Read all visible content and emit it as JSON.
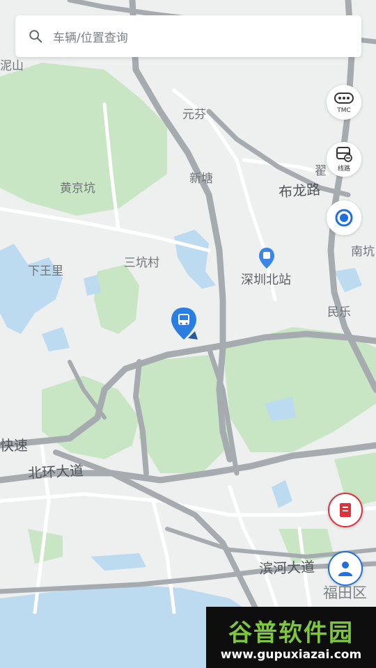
{
  "search": {
    "placeholder": "车辆/位置查询",
    "icon": "search-icon"
  },
  "controls": {
    "tmc": {
      "label": "TMC",
      "icon": "traffic-icon"
    },
    "lines": {
      "label": "线路",
      "icon": "bus-route-icon"
    },
    "locate": {
      "icon": "locate-icon",
      "color": "#1f6fe0"
    },
    "report": {
      "icon": "report-icon",
      "color": "#e0303a"
    },
    "profile": {
      "icon": "person-icon",
      "color": "#1f6fe0"
    }
  },
  "map": {
    "places": [
      {
        "text": "元芬",
        "kind": "place"
      },
      {
        "text": "新塘",
        "kind": "place"
      },
      {
        "text": "黄京坑",
        "kind": "place"
      },
      {
        "text": "三坑村",
        "kind": "place"
      },
      {
        "text": "下王里",
        "kind": "place"
      },
      {
        "text": "深圳北站",
        "kind": "poi"
      },
      {
        "text": "南坑",
        "kind": "place"
      },
      {
        "text": "民乐",
        "kind": "place"
      },
      {
        "text": "翟",
        "kind": "place"
      },
      {
        "text": "泥山",
        "kind": "place"
      },
      {
        "text": "快速",
        "kind": "road"
      },
      {
        "text": "福田区",
        "kind": "district"
      }
    ],
    "roads": [
      {
        "text": "布龙路"
      },
      {
        "text": "北环大道"
      },
      {
        "text": "滨河大道"
      }
    ],
    "colors": {
      "land": "#eef0f0",
      "green": "#c9e6c4",
      "water": "#bcdaf0",
      "road": "#a6abb0",
      "marker": "#2a7de1"
    }
  },
  "watermark": {
    "title": "谷普软件园",
    "url": "www.gupuxiazai.com"
  }
}
